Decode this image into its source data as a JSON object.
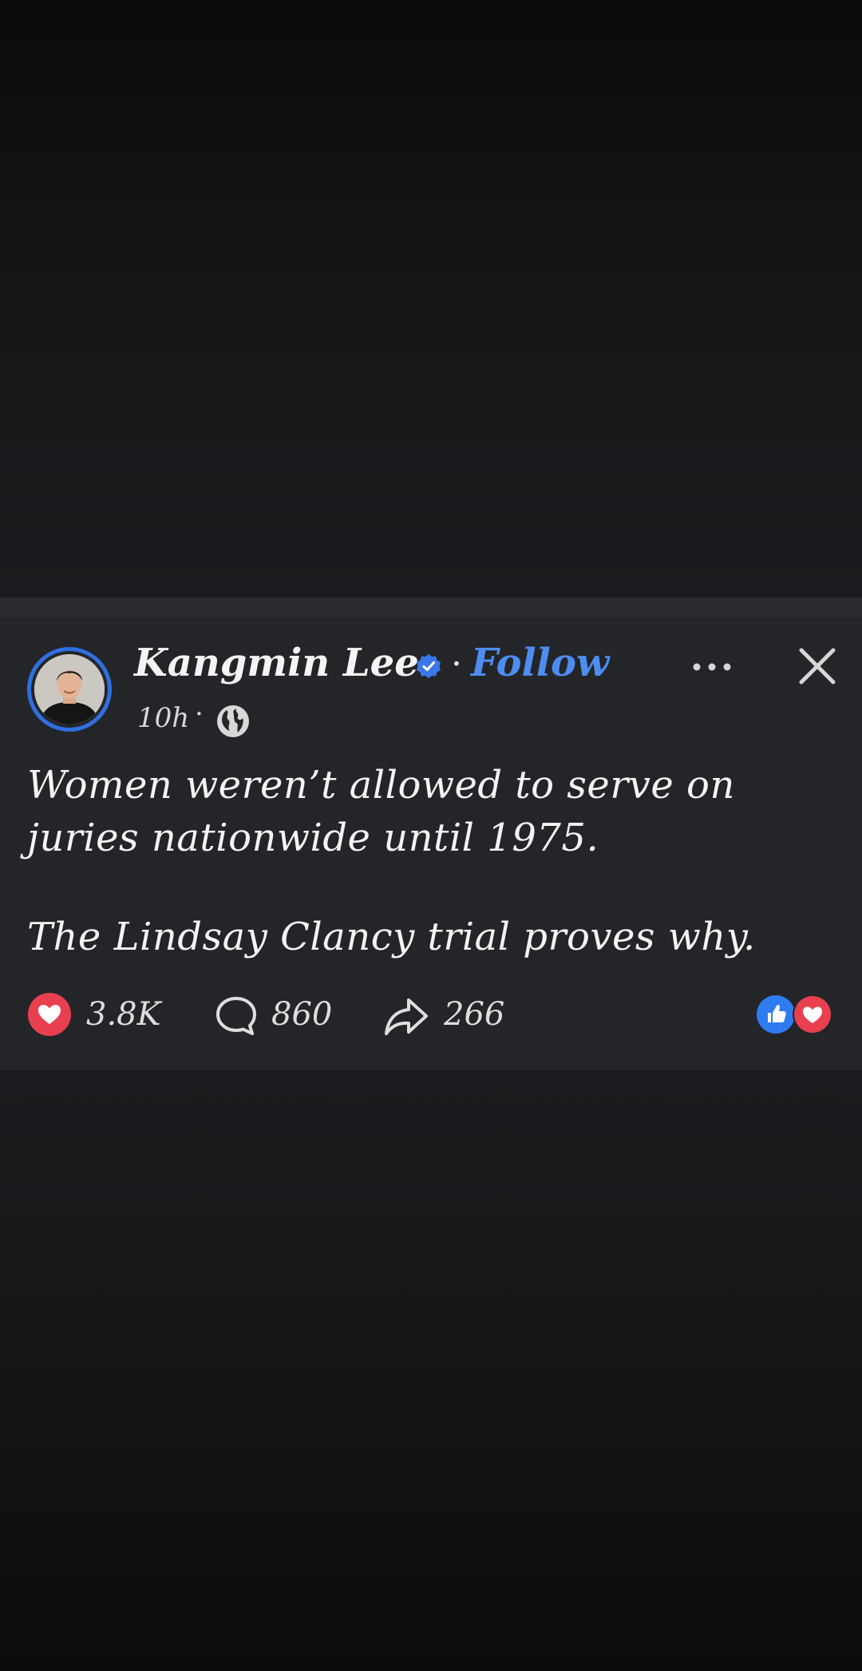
{
  "post": {
    "author_name": "Kangmin Lee",
    "verified_icon": "verified-badge-icon",
    "separator": "·",
    "follow_label": "Follow",
    "timestamp": "10h",
    "audience_icon": "globe-icon",
    "text_line_1": "Women weren’t allowed to serve on",
    "text_line_2": "juries nationwide until 1975.",
    "text_line_3": "The Lindsay Clancy trial proves why.",
    "reaction_count": "3.8K",
    "comment_count": "860",
    "share_count": "266"
  },
  "icons": {
    "more": "more-options-icon",
    "close": "close-icon",
    "reaction": "heart-icon",
    "comment": "comment-bubble-icon",
    "share": "share-arrow-icon",
    "reaction_stack": [
      "like-icon",
      "love-icon"
    ]
  },
  "colors": {
    "accent_blue": "#4d8df0",
    "ring_blue": "#2f6fe0",
    "heart_red": "#e8404f",
    "card_bg": "#242529"
  }
}
